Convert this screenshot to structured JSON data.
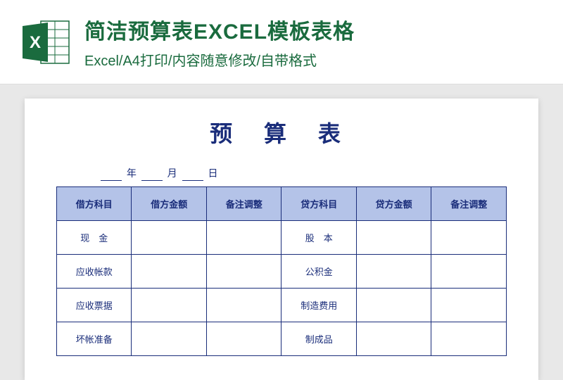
{
  "header": {
    "title": "简洁预算表EXCEL模板表格",
    "subtitle": "Excel/A4打印/内容随意修改/自带格式"
  },
  "document": {
    "title": "预 算 表",
    "date_labels": {
      "year": "年",
      "month": "月",
      "day": "日"
    },
    "table": {
      "headers": [
        "借方科目",
        "借方金额",
        "备注调整",
        "贷方科目",
        "贷方金额",
        "备注调整"
      ],
      "rows": [
        {
          "col1": "现　金",
          "col2": "",
          "col3": "",
          "col4": "股　本",
          "col5": "",
          "col6": ""
        },
        {
          "col1": "应收帐款",
          "col2": "",
          "col3": "",
          "col4": "公积金",
          "col5": "",
          "col6": ""
        },
        {
          "col1": "应收票据",
          "col2": "",
          "col3": "",
          "col4": "制造费用",
          "col5": "",
          "col6": ""
        },
        {
          "col1": "坏帐准备",
          "col2": "",
          "col3": "",
          "col4": "制成品",
          "col5": "",
          "col6": ""
        }
      ]
    }
  }
}
